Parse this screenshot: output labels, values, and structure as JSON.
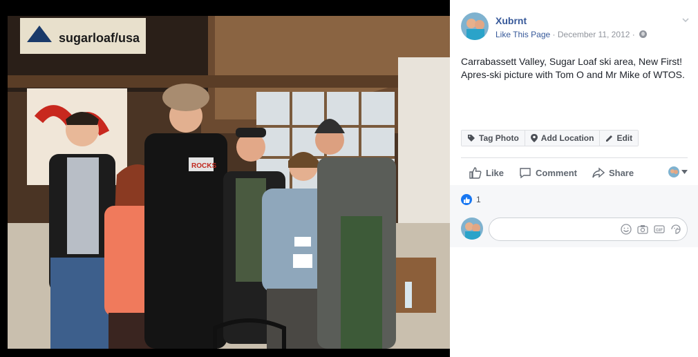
{
  "post": {
    "author": "Xubrnt",
    "page_link": "Like This Page",
    "dot": "·",
    "date": "December 11, 2012",
    "caption": "Carrabassett Valley, Sugar Loaf ski area, New First! Apres-ski picture with Tom O and Mr Mike of WTOS."
  },
  "photo": {
    "banner_text": "sugarloaf/usa",
    "shirt_text": "ROCKS"
  },
  "toolbar": {
    "tag_photo": "Tag Photo",
    "add_location": "Add Location",
    "edit": "Edit"
  },
  "actions": {
    "like": "Like",
    "comment": "Comment",
    "share": "Share"
  },
  "reactions": {
    "count": "1"
  },
  "colors": {
    "link": "#365899",
    "like_blue": "#1877f2",
    "meta_gray": "#90949c"
  },
  "comment_box": {
    "icons": [
      "smiley-icon",
      "camera-icon",
      "gif-icon",
      "sticker-icon"
    ],
    "gif_label": "GIF"
  }
}
